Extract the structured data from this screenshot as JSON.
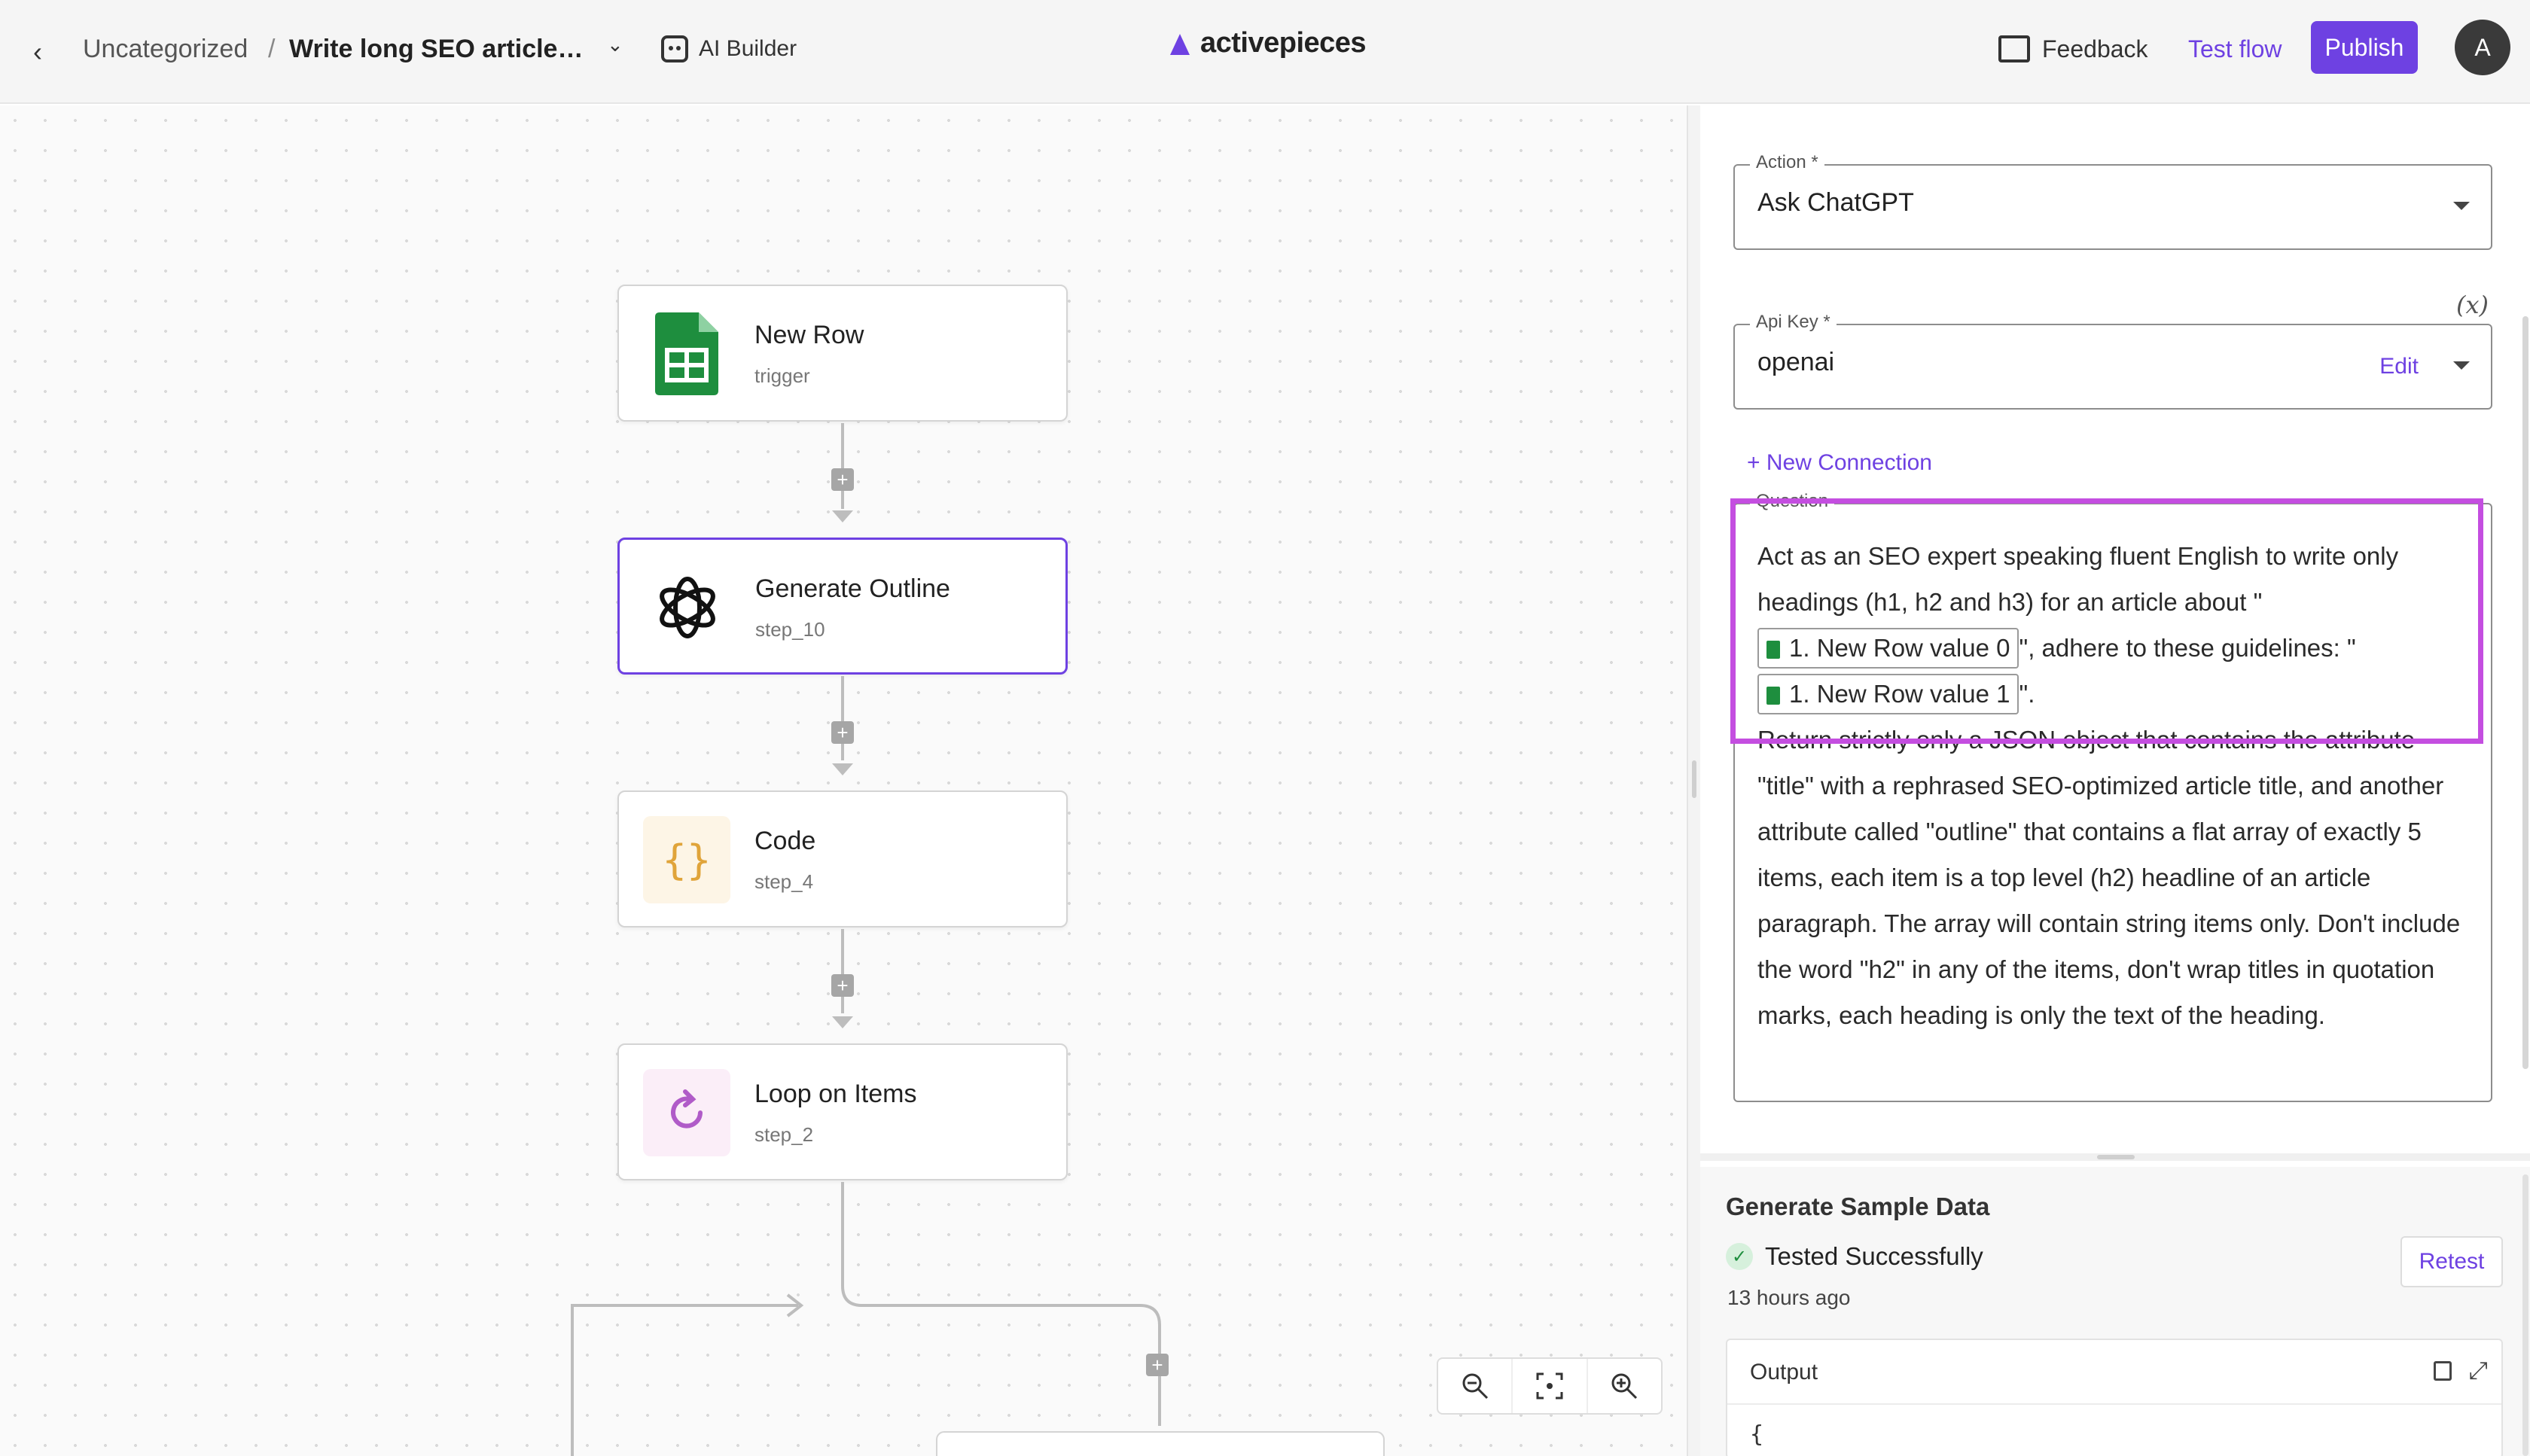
{
  "topbar": {
    "breadcrumb_folder": "Uncategorized",
    "breadcrumb_separator": "/",
    "flow_name": "Write long SEO articles...",
    "ai_builder": "AI Builder",
    "logo_text": "activepieces",
    "feedback": "Feedback",
    "test_flow": "Test flow",
    "publish": "Publish",
    "avatar_initial": "A"
  },
  "flow": {
    "nodes": [
      {
        "title": "New Row",
        "sub": "trigger",
        "icon": "google-sheets-icon"
      },
      {
        "title": "Generate Outline",
        "sub": "step_10",
        "icon": "openai-icon"
      },
      {
        "title": "Code",
        "sub": "step_4",
        "icon": "code-braces-icon"
      },
      {
        "title": "Loop on Items",
        "sub": "step_2",
        "icon": "loop-icon"
      }
    ],
    "plus_label": "+"
  },
  "panel": {
    "action_label": "Action *",
    "action_value": "Ask ChatGPT",
    "fx_label": "(x)",
    "api_key_label": "Api Key *",
    "api_key_value": "openai",
    "api_key_edit": "Edit",
    "new_connection": "+ New Connection",
    "question_label": "Question",
    "question": {
      "part1": "Act as an SEO expert speaking fluent English to write only headings (h1, h2 and h3) for an article about \"",
      "chip1": "1. New Row value 0",
      "part2": "\", adhere to these guidelines: \"",
      "chip2": "1. New Row value 1",
      "part3": "\".",
      "part4": "Return strictly only a JSON object that contains the attribute \"title\" with a rephrased SEO-optimized article title, and another attribute called \"outline\" that contains a flat array of exactly 5 items, each item is a top level (h2) headline of an article paragraph. The array will contain string items only. Don't include the word \"h2\" in any of the items, don't wrap titles in quotation marks, each heading is only the text of the heading."
    }
  },
  "sample": {
    "title": "Generate Sample Data",
    "status": "Tested Successfully",
    "time_ago": "13 hours ago",
    "retest": "Retest",
    "output_label": "Output",
    "output_first_line": "{"
  },
  "colors": {
    "accent": "#6e41e2",
    "highlight": "#c44ee0",
    "sheets_green": "#1e8e3e"
  }
}
